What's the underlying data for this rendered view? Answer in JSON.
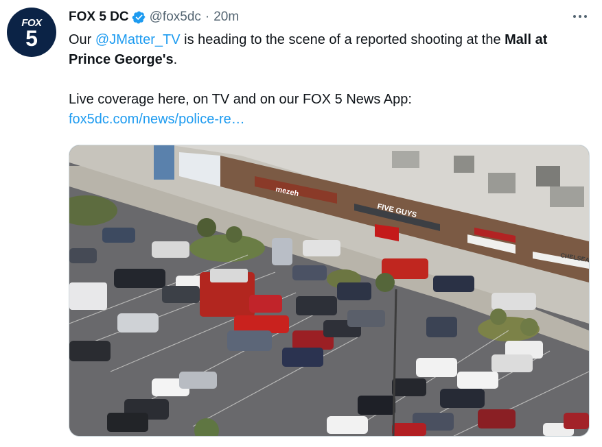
{
  "tweet": {
    "avatar_line1": "FOX",
    "avatar_line2": "5",
    "display_name": "FOX 5 DC",
    "handle": "@fox5dc",
    "separator": "·",
    "time": "20m",
    "text": {
      "p1_part1": "Our ",
      "p1_mention": "@JMatter_TV",
      "p1_part2": " is heading to the scene of a reported shooting at the ",
      "p1_bold": "Mall at Prince George's",
      "p1_end": ".",
      "p2_text": "Live coverage here, on TV and on our FOX 5 News App:",
      "p2_link": "fox5dc.com/news/police-re…"
    },
    "media": {
      "signs": {
        "mezeh": "mezeh",
        "five_guys": "FIVE GUYS",
        "chelsea": "CHELSEA"
      }
    }
  },
  "colors": {
    "link": "#1d9bf0",
    "verified": "#1d9bf0",
    "secondary_text": "#536471",
    "avatar_bg": "#0b2346"
  },
  "icons": {
    "verified": "verified-badge-icon",
    "more": "more-dots-icon"
  }
}
